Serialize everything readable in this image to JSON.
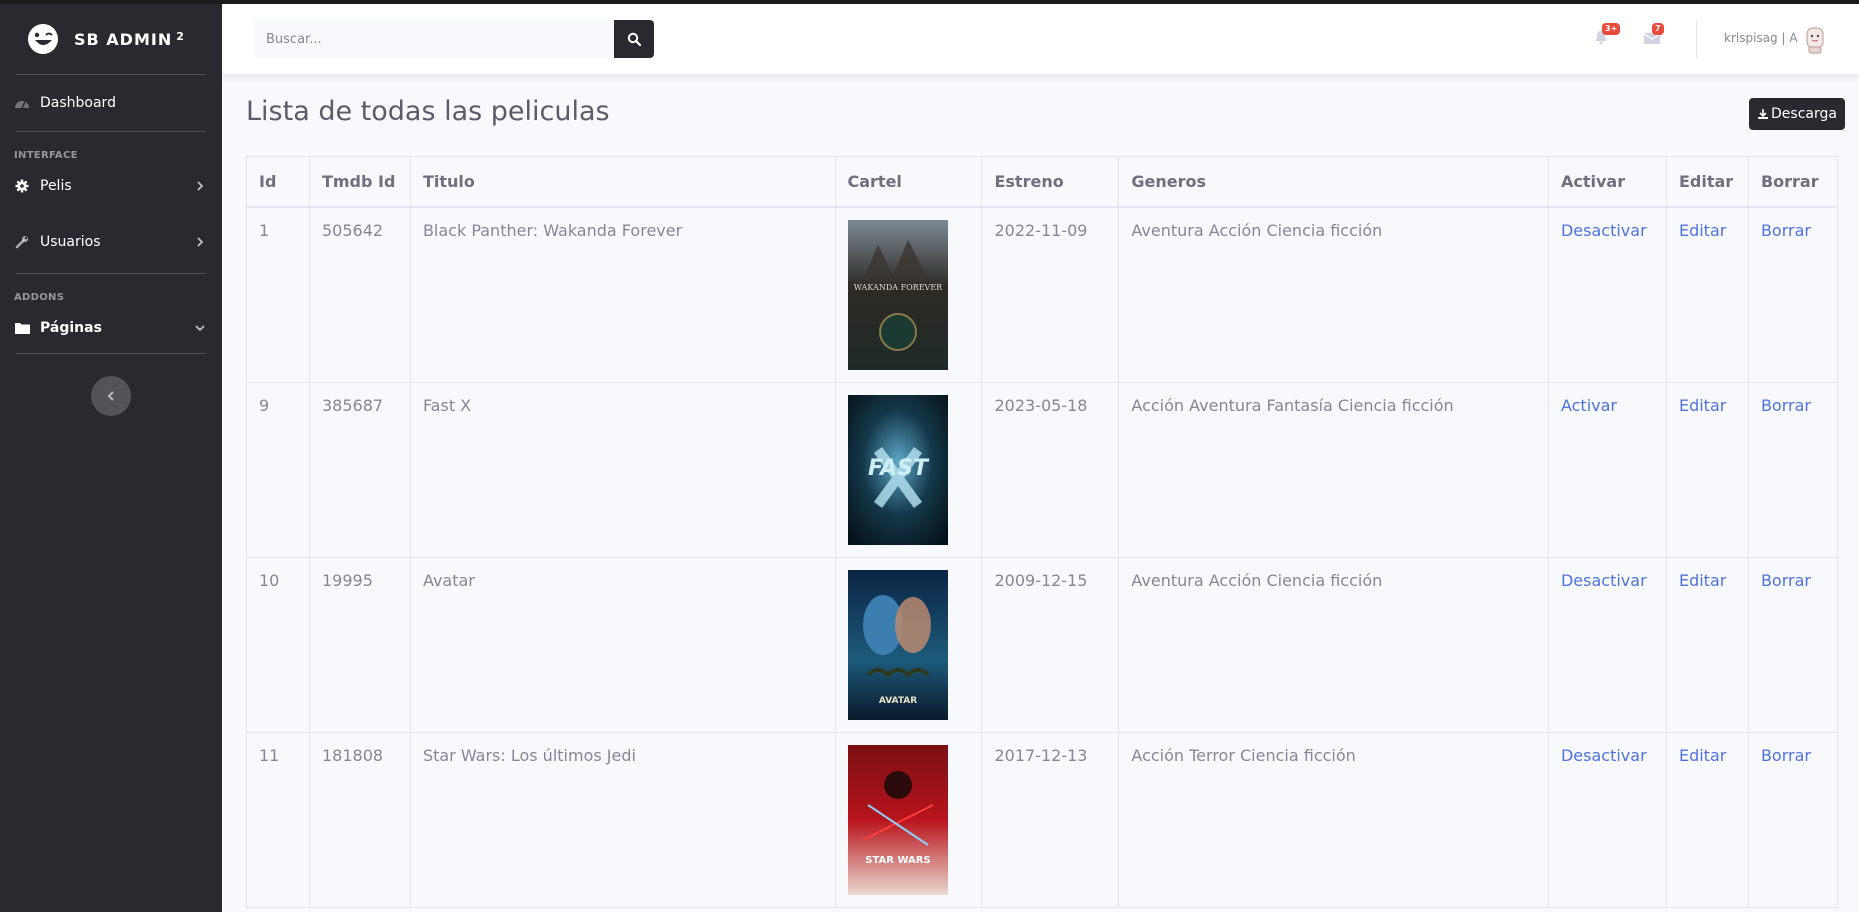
{
  "brand": {
    "name": "SB ADMIN",
    "sup": "2"
  },
  "sidebar": {
    "dashboard": "Dashboard",
    "heading_interface": "INTERFACE",
    "pelis": "Pelis",
    "usuarios": "Usuarios",
    "heading_addons": "ADDONS",
    "paginas": "Páginas"
  },
  "topbar": {
    "search_placeholder": "Buscar...",
    "alerts_badge": "3+",
    "messages_badge": "7",
    "user_name": "krispisag | A"
  },
  "page": {
    "title": "Lista de todas las peliculas",
    "download_label": "Descarga"
  },
  "table": {
    "headers": {
      "id": "Id",
      "tmdb": "Tmdb Id",
      "titulo": "Titulo",
      "cartel": "Cartel",
      "estreno": "Estreno",
      "generos": "Generos",
      "activar": "Activar",
      "editar": "Editar",
      "borrar": "Borrar"
    },
    "rows": [
      {
        "id": "1",
        "tmdb": "505642",
        "titulo": "Black Panther: Wakanda Forever",
        "poster_text": "WAKANDA FOREVER",
        "estreno": "2022-11-09",
        "generos": "Aventura Acción Ciencia ficción",
        "activar": "Desactivar",
        "editar": "Editar",
        "borrar": "Borrar"
      },
      {
        "id": "9",
        "tmdb": "385687",
        "titulo": "Fast X",
        "poster_text": "FAST",
        "estreno": "2023-05-18",
        "generos": "Acción Aventura Fantasía Ciencia ficción",
        "activar": "Activar",
        "editar": "Editar",
        "borrar": "Borrar"
      },
      {
        "id": "10",
        "tmdb": "19995",
        "titulo": "Avatar",
        "poster_text": "AVATAR",
        "estreno": "2009-12-15",
        "generos": "Aventura Acción Ciencia ficción",
        "activar": "Desactivar",
        "editar": "Editar",
        "borrar": "Borrar"
      },
      {
        "id": "11",
        "tmdb": "181808",
        "titulo": "Star Wars: Los últimos Jedi",
        "poster_text": "STAR WARS",
        "estreno": "2017-12-13",
        "generos": "Acción Terror Ciencia ficción",
        "activar": "Desactivar",
        "editar": "Editar",
        "borrar": "Borrar"
      }
    ]
  },
  "colors": {
    "sidebar_bg": "#2a2930",
    "link": "#4e73df",
    "badge": "#e74a3b",
    "text_muted": "#858796"
  }
}
